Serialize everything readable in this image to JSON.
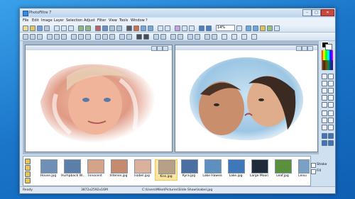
{
  "window": {
    "title": "PhotoFiltre 7",
    "controls": {
      "minimize": "–",
      "maximize": "□",
      "close": "✕"
    }
  },
  "menu": [
    "File",
    "Edit",
    "Image",
    "Layer",
    "Selection",
    "Adjust",
    "Filter",
    "View",
    "Tools",
    "Window",
    "?"
  ],
  "toolbar": {
    "zoom_value": "14%"
  },
  "palette": {
    "options": {
      "stroke_label": "Stroke",
      "fill_label": "Fill"
    }
  },
  "filmstrip": {
    "thumbs": [
      {
        "label": "House.jpg",
        "color": "#6f8fb5"
      },
      {
        "label": "Humpback W...",
        "color": "#5b7fa8"
      },
      {
        "label": "Innocent",
        "color": "#d4a38a"
      },
      {
        "label": "Intense.jpg",
        "color": "#c48b6e"
      },
      {
        "label": "Isabel.jpg",
        "color": "#d9b19c"
      },
      {
        "label": "Kiss.jpg",
        "color": "#b7a086"
      },
      {
        "label": "Kyra.jpg",
        "color": "#4a6fa0"
      },
      {
        "label": "Lake Hawea",
        "color": "#5d8fbf"
      },
      {
        "label": "Lake.jpg",
        "color": "#3e78b8"
      },
      {
        "label": "Large Moon",
        "color": "#1f2a3a"
      },
      {
        "label": "Leaf.jpg",
        "color": "#5a8f3c"
      },
      {
        "label": "Leisu",
        "color": "#7aa0c4"
      }
    ]
  },
  "statusbar": {
    "ready": "Ready",
    "dims": "3872x2592x16M",
    "path": "C:\\Users\\Mike\\Pictures\\Slide Show\\Isabel.jpg"
  },
  "colors": {
    "accent": "#1a75c9",
    "selected_thumb": "#f2c94c"
  }
}
